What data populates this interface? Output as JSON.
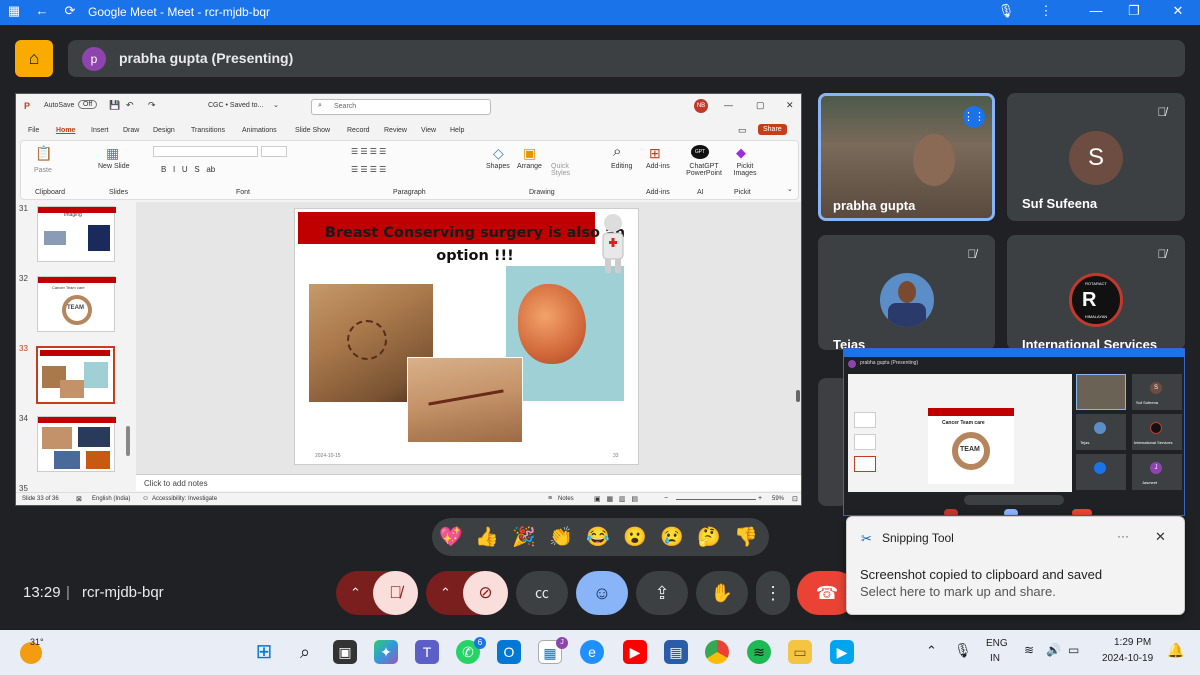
{
  "browser": {
    "title": "Google Meet - Meet - rcr-mjdb-bqr",
    "colors": {
      "titlebar": "#1a73e8"
    }
  },
  "meet": {
    "presenter_initial": "p",
    "presenter_label": "prabha gupta (Presenting)",
    "clock": "13:29",
    "separator": "|",
    "meeting_code": "rcr-mjdb-bqr"
  },
  "ppt": {
    "autosave_label": "AutoSave",
    "autosave_state": "Off",
    "doc_title": "CGC • Saved to...",
    "search_placeholder": "Search",
    "user_initials": "NB",
    "share_label": "Share",
    "menu": [
      "File",
      "Home",
      "Insert",
      "Draw",
      "Design",
      "Transitions",
      "Animations",
      "Slide Show",
      "Record",
      "Review",
      "View",
      "Help"
    ],
    "ribbon": {
      "paste": "Paste",
      "new_slide": "New Slide",
      "clipboard": "Clipboard",
      "slides": "Slides",
      "font": "Font",
      "paragraph": "Paragraph",
      "shapes": "Shapes",
      "arrange": "Arrange",
      "quick_styles": "Quick Styles",
      "drawing": "Drawing",
      "editing": "Editing",
      "addins": "Add-ins",
      "addins_group": "Add-ins",
      "chatgpt": "ChatGPT PowerPoint",
      "ai_group": "AI",
      "pickit": "Pickit Images",
      "pickit_group": "Pickit",
      "gpt_badge": "GPT"
    },
    "thumbnails": [
      {
        "num": "31",
        "title": "Imaging"
      },
      {
        "num": "32",
        "title": "Cancer Team care",
        "badge": "TEAM"
      },
      {
        "num": "33",
        "title": "Breast Conserving"
      },
      {
        "num": "34",
        "title": ""
      },
      {
        "num": "35",
        "title": ""
      }
    ],
    "slide": {
      "title_line1": "Breast Conserving surgery is also an",
      "title_line2": "option !!!",
      "date": "2024-10-15",
      "number": "33"
    },
    "notes_placeholder": "Click to add notes",
    "status": {
      "slide_of": "Slide 33 of 36",
      "language": "English (India)",
      "accessibility": "Accessibility: Investigate",
      "notes": "Notes",
      "zoom": "59%"
    }
  },
  "participants": [
    {
      "name": "prabha gupta",
      "speaking": true
    },
    {
      "name": "Suf Sufeena",
      "initial": "S",
      "muted": true
    },
    {
      "name": "Tejas",
      "muted": true
    },
    {
      "name": "International Services",
      "muted": true,
      "logo_text": "ROTARACT",
      "logo_sub": "HIMALAYAN"
    }
  ],
  "mini_window": {
    "title": "prabha gupta (Presenting)",
    "slide_title": "Cancer Team care",
    "badge": "TEAM",
    "tiles": [
      "Suf Sufeena",
      "Tejas",
      "International Services",
      "Jasmeet"
    ],
    "tile_initials": [
      "S",
      "J"
    ]
  },
  "reactions": [
    "💖",
    "👍",
    "🎉",
    "👏",
    "😂",
    "😮",
    "😢",
    "🤔",
    "👎"
  ],
  "toast": {
    "app": "Snipping Tool",
    "more": "···",
    "line1": "Screenshot copied to clipboard and saved",
    "line2": "Select here to mark up and share."
  },
  "taskbar": {
    "weather": "31°",
    "badges": {
      "whatsapp": "6",
      "extra": "J"
    },
    "lang1": "ENG",
    "lang2": "IN",
    "time": "1:29 PM",
    "date": "2024-10-19"
  }
}
